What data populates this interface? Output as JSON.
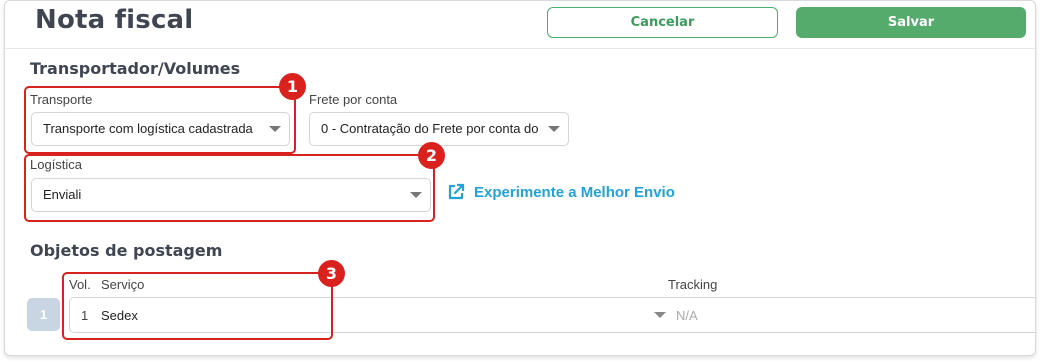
{
  "header": {
    "title": "Nota fiscal",
    "cancel_label": "Cancelar",
    "save_label": "Salvar"
  },
  "transport_section": {
    "title": "Transportador/Volumes",
    "transporte": {
      "label": "Transporte",
      "value": "Transporte com logística cadastrada"
    },
    "frete": {
      "label": "Frete por conta",
      "value": "0 - Contratação do Frete por conta do"
    },
    "logistica": {
      "label": "Logística",
      "value": "Enviali"
    },
    "link_label": "Experimente a Melhor Envio"
  },
  "postage_section": {
    "title": "Objetos de postagem",
    "columns": {
      "vol": "Vol.",
      "servico": "Serviço",
      "tracking": "Tracking"
    },
    "rows": [
      {
        "volume_button": "1",
        "vol": "1",
        "servico": "Sedex",
        "tracking": "N/A"
      }
    ]
  },
  "annotations": {
    "badge_1": "1",
    "badge_2": "2",
    "badge_3": "3"
  },
  "colors": {
    "accent_green": "#55ab6c",
    "highlight_red": "#d9211d",
    "link_blue": "#1fa3d8"
  },
  "icons": {
    "select_caret": "caret-down-icon",
    "external_link": "external-link-icon"
  }
}
